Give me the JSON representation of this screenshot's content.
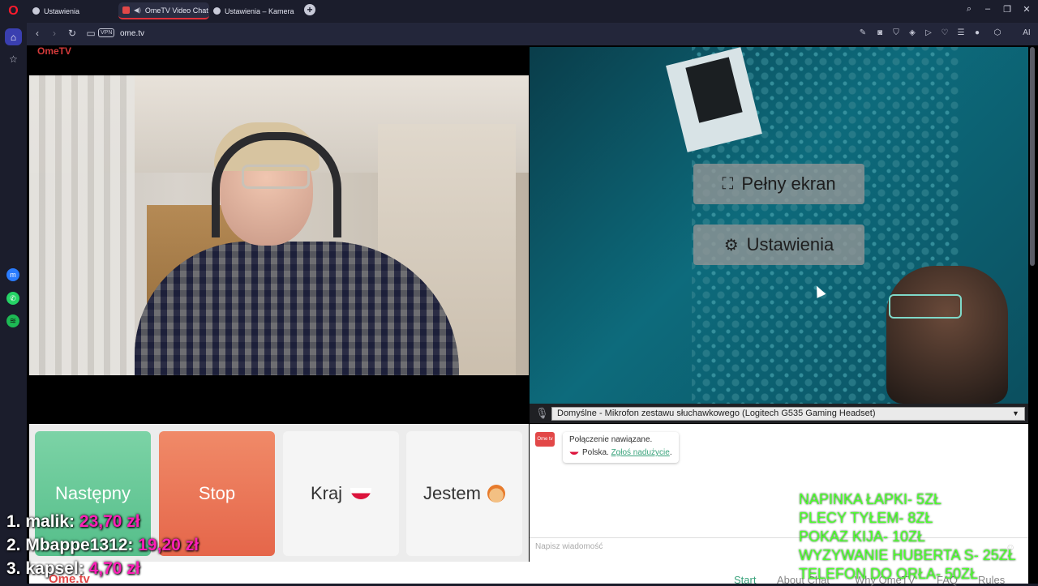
{
  "browser": {
    "tabs": [
      {
        "label": "Ustawienia"
      },
      {
        "label": "OmeTV Video Chat -"
      },
      {
        "label": "Ustawienia – Kamera"
      }
    ],
    "new_tab": "+",
    "url": "ome.tv",
    "vpn_badge": "VPN",
    "ai_label": "AI"
  },
  "video": {
    "left_logo": "OmeTV"
  },
  "overlay": {
    "fullscreen_label": "Pełny ekran",
    "settings_label": "Ustawienia"
  },
  "mic": {
    "selected": "Domyślne - Mikrofon zestawu słuchawkowego (Logitech G535 Gaming Headset)"
  },
  "controls": {
    "next_label": "Następny",
    "stop_label": "Stop",
    "country_label": "Kraj",
    "gender_label": "Jestem"
  },
  "chat": {
    "logo": "Ome tv",
    "connection_msg": "Połączenie nawiązane.",
    "country": "Polska.",
    "report_link": "Zgłoś nadużycie",
    "report_suffix": ".",
    "input_placeholder": "Napisz wiadomość"
  },
  "footer": {
    "logo": "Ome.tv",
    "links": [
      "Start",
      "About Chat",
      "Why OmeTV",
      "FAQ",
      "Rules"
    ]
  },
  "stream_overlay": {
    "donors": [
      {
        "rank": "1.",
        "name": "malik:",
        "amount": "23,70 zł"
      },
      {
        "rank": "2.",
        "name": "Mbappe1312:",
        "amount": "19,20 zł"
      },
      {
        "rank": "3.",
        "name": "kapsel:",
        "amount": "4,70 zł"
      }
    ],
    "price_menu": [
      "NAPINKA ŁAPKI- 5ZŁ",
      "PLECY TYŁEM- 8ZŁ",
      "POKAZ KIJA- 10ZŁ",
      "WYZYWANIE HUBERTA S- 25ZŁ",
      "TELEFON DO ORŁA- 50ZŁ"
    ]
  },
  "colors": {
    "next": "#5cc291",
    "stop": "#e86d50",
    "accent_link": "#3aa37c",
    "donor_amount": "#ff1fb8",
    "menu_text": "#4dff2d"
  }
}
